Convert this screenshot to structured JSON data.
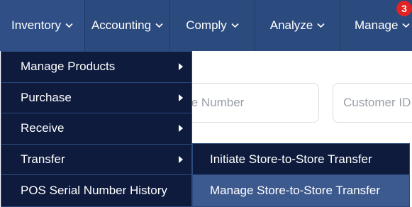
{
  "nav": {
    "items": [
      {
        "label": "Inventory"
      },
      {
        "label": "Accounting"
      },
      {
        "label": "Comply"
      },
      {
        "label": "Analyze"
      },
      {
        "label": "Manage"
      }
    ],
    "badge_count": "3"
  },
  "page": {
    "phone_placeholder": "Phone Number",
    "customer_placeholder": "Customer ID"
  },
  "dropdown": {
    "items": [
      {
        "label": "Manage Products",
        "has_submenu": true
      },
      {
        "label": "Purchase",
        "has_submenu": true
      },
      {
        "label": "Receive",
        "has_submenu": true
      },
      {
        "label": "Transfer",
        "has_submenu": true
      },
      {
        "label": "POS Serial Number History",
        "has_submenu": false
      }
    ]
  },
  "submenu": {
    "items": [
      {
        "label": "Initiate Store-to-Store Transfer"
      },
      {
        "label": "Manage Store-to-Store Transfer"
      }
    ]
  },
  "colors": {
    "navbar": "#2b4a7e",
    "dropdown": "#0e1b3d",
    "highlight": "#3d5a8f",
    "badge": "#e02424"
  }
}
